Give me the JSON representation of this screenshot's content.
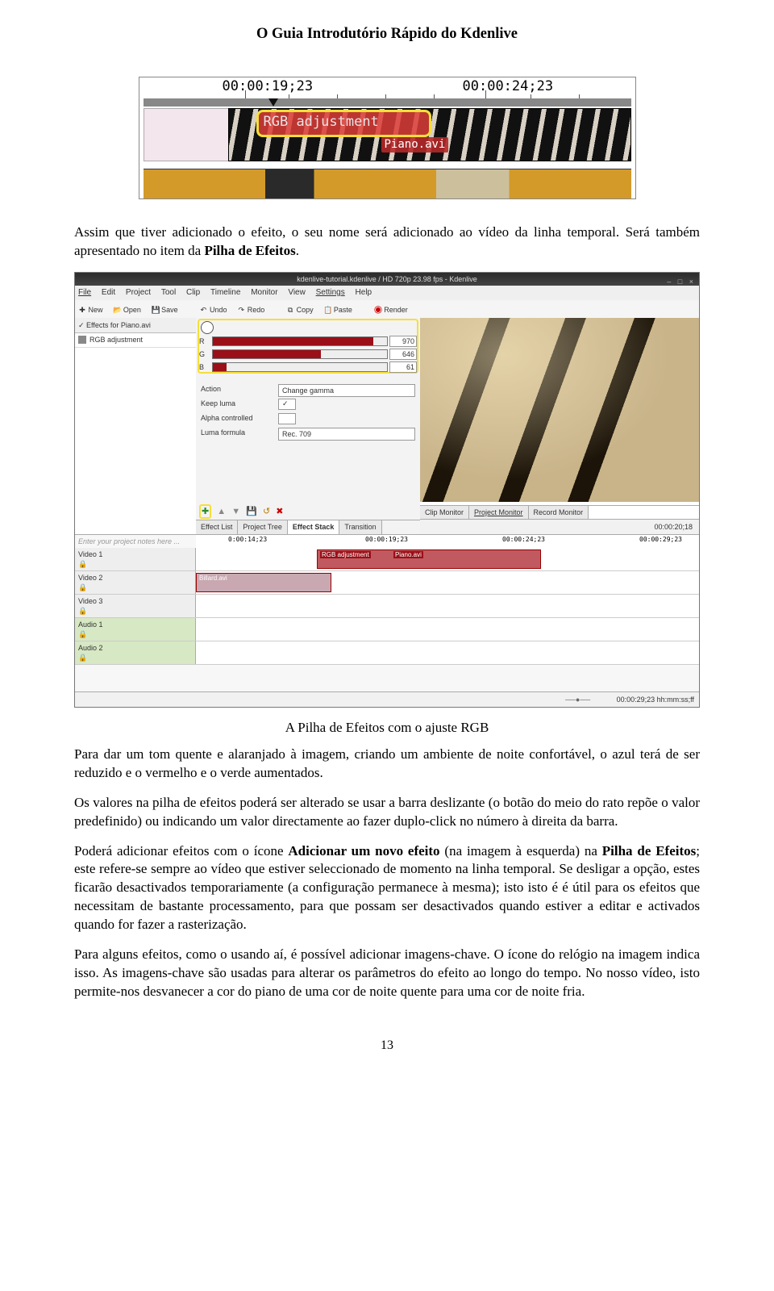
{
  "header_title": "O Guia Introdutório Rápido do Kdenlive",
  "figure1": {
    "tc_left": "00:00:19;23",
    "tc_right": "00:00:24;23",
    "effect_label": "RGB adjustment",
    "clip_name": "Piano.avi"
  },
  "para1_before_bold": "Assim que tiver adicionado o efeito, o seu nome será adicionado ao vídeo da linha temporal. Será também apresentado no item da ",
  "para1_bold": "Pilha de Efeitos",
  "para1_after_bold": ".",
  "figure2": {
    "window_title": "kdenlive-tutorial.kdenlive / HD 720p 23.98 fps - Kdenlive",
    "window_buttons": "– □ ×",
    "menu": [
      "File",
      "Edit",
      "Project",
      "Tool",
      "Clip",
      "Timeline",
      "Monitor",
      "View",
      "Settings",
      "Help"
    ],
    "toolbar": {
      "new": "New",
      "open": "Open",
      "save": "Save",
      "undo": "Undo",
      "redo": "Redo",
      "copy": "Copy",
      "paste": "Paste",
      "render": "Render"
    },
    "effects_for": "Effects for Piano.avi",
    "effect_row": "RGB adjustment",
    "sliders": {
      "R": "970",
      "G": "646",
      "B": "61"
    },
    "props": {
      "action_label": "Action",
      "action_value": "Change gamma",
      "keep_luma_label": "Keep luma",
      "alpha_label": "Alpha controlled",
      "luma_formula_label": "Luma formula",
      "luma_formula_value": "Rec. 709"
    },
    "mid_tabs": [
      "Effect List",
      "Project Tree",
      "Effect Stack",
      "Transition"
    ],
    "mid_tab_active": "Effect Stack",
    "viewer_tabs": [
      "Clip Monitor",
      "Project Monitor",
      "Record Monitor"
    ],
    "viewer_tc": "00:00:20;18",
    "notes_placeholder": "Enter your project notes here ...",
    "timeline_tcs": [
      "0:00:14;23",
      "00:00:19;23",
      "00:00:24;23",
      "00:00:29;23"
    ],
    "tracks": {
      "v1": "Video 1",
      "v2": "Video 2",
      "v3": "Video 3",
      "a1": "Audio 1",
      "a2": "Audio 2"
    },
    "clip_v1_effect": "RGB adjustment",
    "clip_v1_name": "Piano.avi",
    "clip_v2_name": "Billard.avi",
    "status_tc": "00:00:29;23  hh:mm:ss;ff"
  },
  "caption": "A Pilha de Efeitos com o ajuste RGB",
  "para2": "Para dar um tom quente e alaranjado à imagem, criando um ambiente de noite confortável, o azul terá de ser reduzido e o vermelho e o verde aumentados.",
  "para3": "Os valores na pilha de efeitos poderá ser alterado se usar a barra deslizante (o botão do meio do rato repõe o valor predefinido) ou indicando um valor directamente ao fazer duplo-click no número à direita da barra.",
  "para4_a": "Poderá adicionar efeitos com o ícone ",
  "para4_bold1": "Adicionar um novo efeito",
  "para4_b": " (na imagem à esquerda) na ",
  "para4_bold2": "Pilha de Efeitos",
  "para4_c": "; este refere-se sempre ao vídeo que estiver seleccionado de momento na linha temporal. Se desligar a opção, estes ficarão desactivados temporariamente (a configuração permanece à mesma); isto isto é é útil para os efeitos que necessitam de bastante processamento, para que possam ser desactivados quando estiver a editar e activados quando for fazer a rasterização.",
  "para5": "Para alguns efeitos, como o usando aí, é possível adicionar imagens-chave. O ícone do relógio na imagem indica isso. As imagens-chave são usadas para alterar os parâmetros do efeito ao longo do tempo. No nosso vídeo, isto permite-nos desvanecer a cor do piano de uma cor de noite quente para uma cor de noite fria.",
  "page_number": "13"
}
